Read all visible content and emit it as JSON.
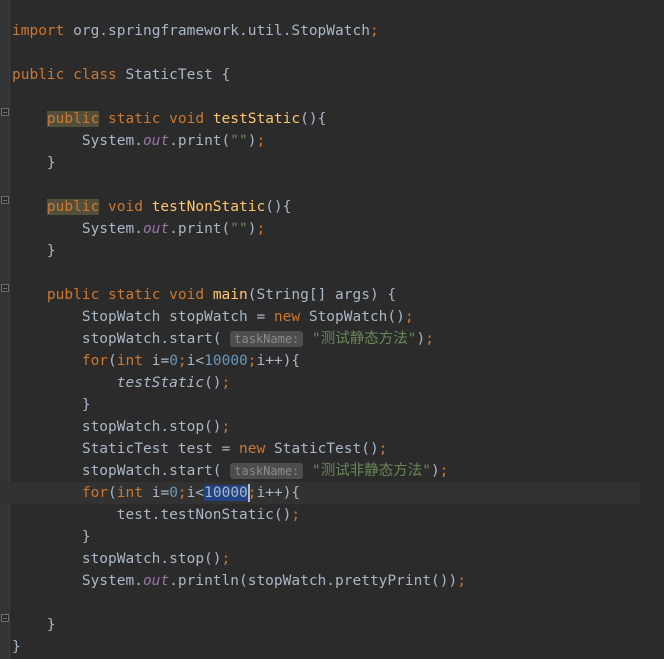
{
  "code": {
    "import_kw": "import",
    "import_pkg": " org.springframework.util.StopWatch",
    "class_decl_public": "public",
    "class_decl_class": "class",
    "class_name": " StaticTest {",
    "m1_public": "public",
    "m1_static": "static",
    "m1_void": "void",
    "m1_name": "testStatic",
    "m1_sig": "(){",
    "sysout_sys": "System.",
    "sysout_out": "out",
    "sysout_print": ".print(",
    "empty_str": "\"\"",
    "m2_public": "public",
    "m2_void": "void",
    "m2_name": "testNonStatic",
    "m2_sig": "(){",
    "main_public": "public",
    "main_static": "static",
    "main_void": "void",
    "main_name": "main",
    "main_sig": "(String[] args) {",
    "sw_decl": "StopWatch stopWatch = ",
    "new_kw": "new",
    "sw_ctor": " StopWatch()",
    "sw_start": "stopWatch.start( ",
    "hint_taskname": "taskName:",
    "str1": "\"测试静态方法\"",
    "for_kw": "for",
    "int_kw": "int",
    "for_init": " i=",
    "zero": "0",
    "for_cond": "i<",
    "ten_k": "10000",
    "for_inc": "i++){",
    "call_teststatic": "testStatic",
    "sw_stop": "stopWatch.stop()",
    "st_decl": "StaticTest test = ",
    "st_ctor": " StaticTest()",
    "str2": "\"测试非静态方法\"",
    "call_nonstatic": "test.testNonStatic()",
    "println": ".println(stopWatch.prettyPrint())",
    "semi": ";",
    "close_brace": "}",
    "paren_close": ")",
    "paren_close_semi": ");",
    "space": " "
  }
}
